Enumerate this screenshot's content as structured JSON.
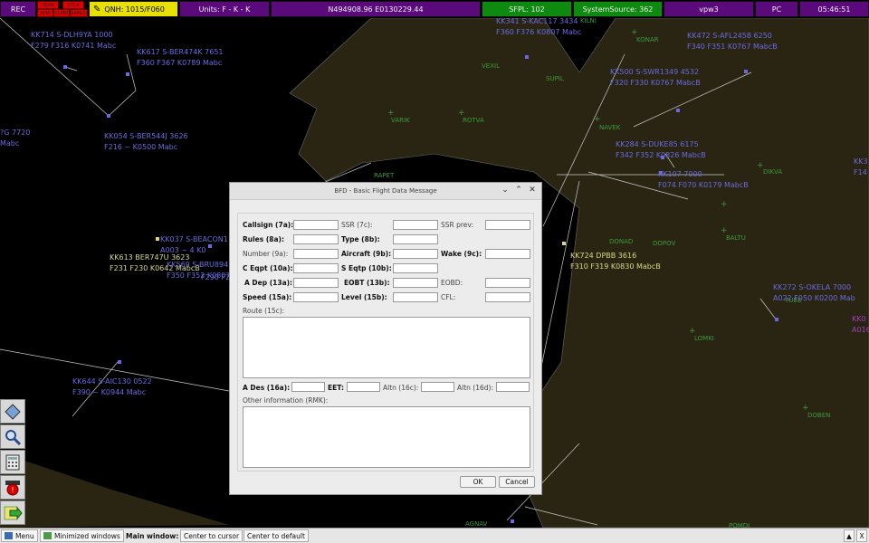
{
  "topbar": {
    "rec": "REC",
    "mini": [
      "HEAR",
      "STCA",
      "APW",
      "CLMM",
      "RAMLD"
    ],
    "qnh": "QNH: 1015/F060",
    "units": "Units: F - K - K",
    "coords": "N494908.96 E0130229.44",
    "sfpl": "SFPL: 102",
    "system_source": "SystemSource: 362",
    "user": "vpw3",
    "host": "PC",
    "clock": "05:46:51",
    "colors": {
      "status_red": "#e00000",
      "qnh_yellow": "#e8e000",
      "panel_purple": "#5a0a7a",
      "sfpl_green": "#0f8a10"
    }
  },
  "map": {
    "sector_fill": "#2a2512",
    "track_color": "#6a6ae0",
    "selected_track_color": "#d8d888",
    "fix_color": "#3c9a3c",
    "tracks": [
      {
        "l1": "KK714 S-DLH9YA  1000",
        "l2": "F279 F316 K0741 Mabc",
        "color": "blue"
      },
      {
        "l1": "KK617 S-BER474K 7651",
        "l2": "F360 F367 K0789 Mabc",
        "color": "blue"
      },
      {
        "l1": "KK054 S-BER544J 3626",
        "l2": "F216 ~ K0500 Mabc",
        "color": "blue"
      },
      {
        "l1": "?G  7720",
        "l2": "Mabc",
        "color": "blue"
      },
      {
        "l1": "KK341 S-KAC117  3434",
        "l2": "F360 F376 K0807 Mabc",
        "color": "blue"
      },
      {
        "l1": "KK472 S-AFL2458 6250",
        "l2": "F340 F351 K0767 MabcB",
        "color": "blue"
      },
      {
        "l1": "KK500 S-SWR1349 4532",
        "l2": "F320 F330 K0767 MabcB",
        "color": "blue"
      },
      {
        "l1": "KK284 S-DUKE85  6175",
        "l2": "F342 F352 K0826 MabcB",
        "color": "blue"
      },
      {
        "l1": "KK107 7000",
        "l2": "F074 F070 K0179 MabcB",
        "color": "blue"
      },
      {
        "l1": "KK037 S-BEACON1",
        "l2": "A003 ~ 4 K0",
        "color": "blue"
      },
      {
        "l1": "KK613 BER747U 3623",
        "l2": "F231 F230 K0642 MabcB",
        "color": "yellow"
      },
      {
        "l1": "KK569 S-BRU894",
        "l2": "F350 F352 K0807",
        "color": "blue"
      },
      {
        "l1": "",
        "l2": "F290 F2",
        "color": "blue"
      },
      {
        "l1": "KK724 DPBB 3616",
        "l2": "F310 F319 K0830 MabcB",
        "color": "yellow"
      },
      {
        "l1": "KK272 S-OKELA   7000",
        "l2": "A022 F050 K0200 Mab",
        "color": "blue"
      },
      {
        "l1": "KK644 S-AIC130  0522",
        "l2": "F390 ~ K0944 Mabc",
        "color": "blue"
      },
      {
        "l1": "KK0",
        "l2": "A016",
        "color": "blue"
      },
      {
        "l1": "KK3",
        "l2": "F14",
        "color": "blue"
      }
    ],
    "fixes": [
      "VEXIL",
      "SUPIL",
      "KONAR",
      "VARIK",
      "ROTVA",
      "NAVEK",
      "DIKVA",
      "RAPET",
      "DONAD",
      "DOPOV",
      "BALTU",
      "LOMKI",
      "DOBEN",
      "AGNAV",
      "POMDI",
      "KILNI",
      "TUBE"
    ]
  },
  "dialog": {
    "title": "BFD - Basic Flight Data Message",
    "labels": {
      "callsign": "Callsign (7a):",
      "ssr": "SSR (7c):",
      "ssr_prev": "SSR prev:",
      "rules": "Rules (8a):",
      "type": "Type (8b):",
      "number": "Number (9a):",
      "aircraft": "Aircraft (9b):",
      "wake": "Wake (9c):",
      "c_eqpt": "C Eqpt (10a):",
      "s_eqtp": "S Eqtp (10b):",
      "a_dep": "A Dep (13a):",
      "eobt": "EOBT (13b):",
      "eobd": "EOBD:",
      "speed": "Speed (15a):",
      "level": "Level (15b):",
      "cfl": "CFL:",
      "route": "Route (15c):",
      "a_des": "A Des (16a):",
      "eet": "EET:",
      "altn_16c": "Altn (16c):",
      "altn_16d": "Altn (16d):",
      "other_info": "Other information  (RMK):"
    },
    "ok": "OK",
    "cancel": "Cancel"
  },
  "left_toolbar": [
    "map-tool-icon",
    "zoom-icon",
    "calculator-icon",
    "alarm-icon",
    "exit-icon"
  ],
  "bottombar": {
    "menu": "Menu",
    "minimized": "Minimized windows",
    "main_window": "Main window:",
    "center_cursor": "Center to cursor",
    "center_default": "Center to default",
    "up": "▲",
    "close": "X"
  }
}
